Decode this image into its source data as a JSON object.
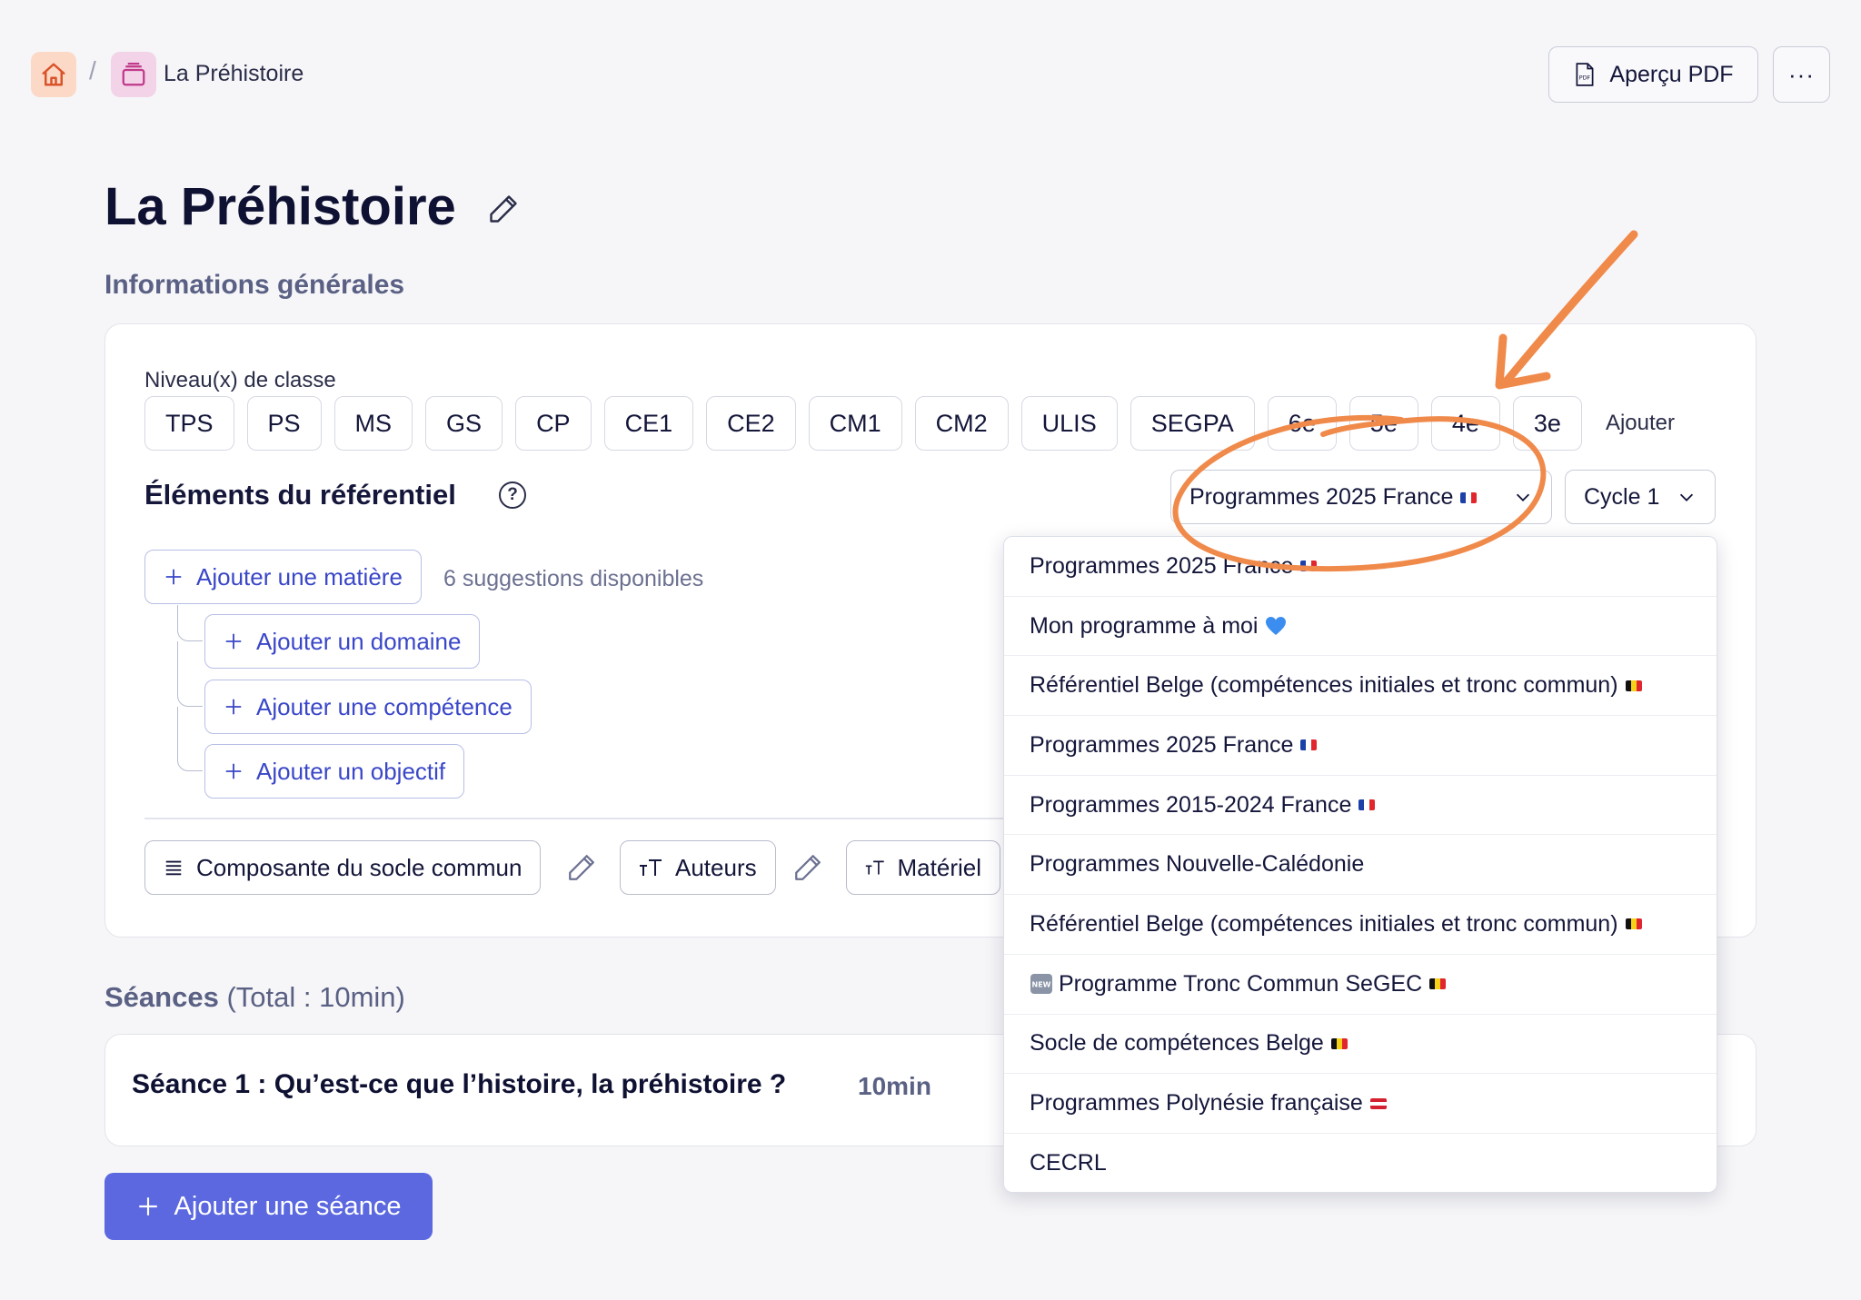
{
  "breadcrumb": {
    "separator": "/",
    "current": "La Préhistoire"
  },
  "header": {
    "pdf_label": "Aperçu PDF",
    "more_label": "···"
  },
  "page": {
    "title": "La Préhistoire",
    "section_info": "Informations générales"
  },
  "levels": {
    "label": "Niveau(x) de classe",
    "items": [
      "TPS",
      "PS",
      "MS",
      "GS",
      "CP",
      "CE1",
      "CE2",
      "CM1",
      "CM2",
      "ULIS",
      "SEGPA",
      "6e",
      "5e",
      "4e",
      "3e"
    ],
    "add_label": "Ajouter"
  },
  "referentiel": {
    "title": "Éléments du référentiel",
    "help": "?",
    "program_selected": "Programmes 2025 France",
    "cycle_selected": "Cycle 1",
    "add_matiere": "Ajouter une matière",
    "suggestions": "6 suggestions disponibles",
    "add_domaine": "Ajouter un domaine",
    "add_competence": "Ajouter une compétence",
    "add_objectif": "Ajouter un objectif"
  },
  "fields": {
    "socle": "Composante du socle commun",
    "auteurs": "Auteurs",
    "materiel": "Matériel"
  },
  "seances": {
    "label": "Séances",
    "total": "(Total : 10min)",
    "items": [
      {
        "title": "Séance 1 : Qu’est-ce que l’histoire, la préhistoire ?",
        "duration": "10min"
      }
    ],
    "add_label": "Ajouter une séance"
  },
  "dropdown": {
    "options": [
      {
        "label": "Programmes 2025 France",
        "flag": "fr"
      },
      {
        "label": "Mon programme à moi",
        "flag": "heart"
      },
      {
        "label": "Référentiel Belge (compétences initiales et tronc commun)",
        "flag": "be"
      },
      {
        "label": "Programmes 2025 France",
        "flag": "fr"
      },
      {
        "label": "Programmes 2015-2024 France",
        "flag": "fr"
      },
      {
        "label": "Programmes Nouvelle-Calédonie",
        "flag": ""
      },
      {
        "label": "Référentiel Belge (compétences initiales et tronc commun)",
        "flag": "be"
      },
      {
        "label": "Programme Tronc Commun SeGEC",
        "flag": "be",
        "prefix": "new"
      },
      {
        "label": "Socle de compétences Belge",
        "flag": "be"
      },
      {
        "label": "Programmes Polynésie française",
        "flag": "pf"
      },
      {
        "label": "CECRL",
        "flag": ""
      }
    ]
  },
  "colors": {
    "accent": "#5b68e0",
    "link": "#3a47c8",
    "annotation": "#f08a4b"
  }
}
